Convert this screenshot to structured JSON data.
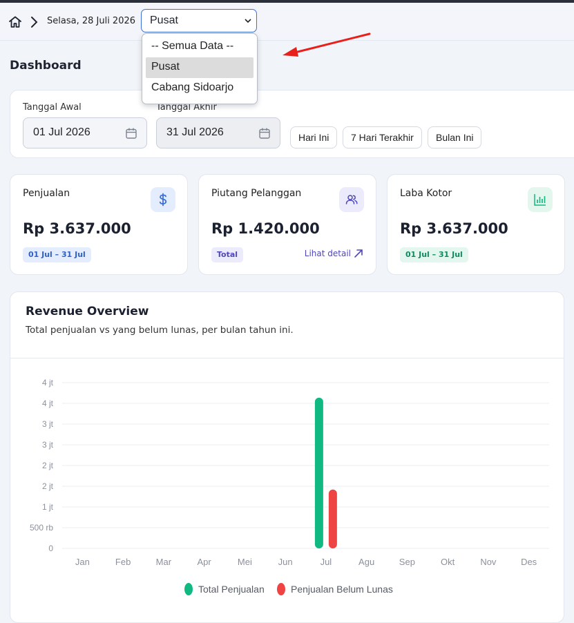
{
  "header": {
    "date": "Selasa, 28 Juli 2026",
    "branch_selected": "Pusat",
    "branch_options": [
      "-- Semua Data --",
      "Pusat",
      "Cabang Sidoarjo"
    ]
  },
  "page_title": "Dashboard",
  "filters": {
    "start_label": "Tanggal Awal",
    "start_value": "01 Jul 2026",
    "end_label": "Tanggal Akhir",
    "end_value": "31 Jul 2026",
    "quick": [
      "Hari Ini",
      "7 Hari Terakhir",
      "Bulan Ini"
    ]
  },
  "cards": [
    {
      "title": "Penjualan",
      "value": "Rp 3.637.000",
      "badge": "01 Jul – 31 Jul",
      "icon": "dollar-icon"
    },
    {
      "title": "Piutang Pelanggan",
      "value": "Rp 1.420.000",
      "badge": "Total",
      "link": "Lihat detail",
      "icon": "users-icon"
    },
    {
      "title": "Laba Kotor",
      "value": "Rp 3.637.000",
      "badge": "01 Jul – 31 Jul",
      "icon": "bar-chart-icon"
    }
  ],
  "colors": {
    "accent": "#3b6fd8",
    "green": "#10b981",
    "red": "#ef4444",
    "indigo": "#4f46b8"
  },
  "chart_data": {
    "type": "bar",
    "title": "Revenue Overview",
    "subtitle": "Total penjualan vs yang belum lunas, per bulan tahun ini.",
    "categories": [
      "Jan",
      "Feb",
      "Mar",
      "Apr",
      "Mei",
      "Jun",
      "Jul",
      "Agu",
      "Sep",
      "Okt",
      "Nov",
      "Des"
    ],
    "series": [
      {
        "name": "Total Penjualan",
        "color": "#10b981",
        "values": [
          0,
          0,
          0,
          0,
          0,
          0,
          3637000,
          0,
          0,
          0,
          0,
          0
        ]
      },
      {
        "name": "Penjualan Belum Lunas",
        "color": "#ef4444",
        "values": [
          0,
          0,
          0,
          0,
          0,
          0,
          1420000,
          0,
          0,
          0,
          0,
          0
        ]
      }
    ],
    "ylim": [
      0,
      4000000
    ],
    "yticks": [
      {
        "value": 0,
        "label": "0"
      },
      {
        "value": 500000,
        "label": "500 rb"
      },
      {
        "value": 1000000,
        "label": "1 jt"
      },
      {
        "value": 1500000,
        "label": "2 jt"
      },
      {
        "value": 2000000,
        "label": "2 jt"
      },
      {
        "value": 2500000,
        "label": "3 jt"
      },
      {
        "value": 3000000,
        "label": "3 jt"
      },
      {
        "value": 3500000,
        "label": "4 jt"
      },
      {
        "value": 4000000,
        "label": "4 jt"
      }
    ],
    "grid": true,
    "legend": "bottom-center"
  }
}
